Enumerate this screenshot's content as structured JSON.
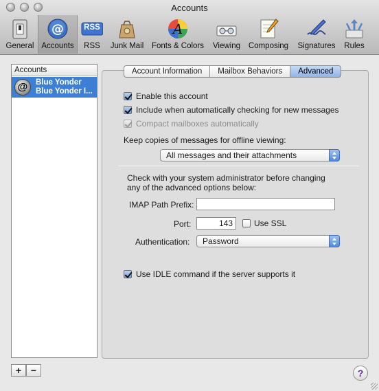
{
  "window": {
    "title": "Accounts"
  },
  "toolbar": {
    "items": [
      {
        "label": "General"
      },
      {
        "label": "Accounts",
        "selected": true
      },
      {
        "label": "RSS"
      },
      {
        "label": "Junk Mail"
      },
      {
        "label": "Fonts & Colors"
      },
      {
        "label": "Viewing"
      },
      {
        "label": "Composing"
      },
      {
        "label": "Signatures"
      },
      {
        "label": "Rules"
      }
    ],
    "rss_badge": "RSS"
  },
  "sidebar": {
    "header": "Accounts",
    "accounts": [
      {
        "name": "Blue Yonder",
        "detail": "Blue Yonder I...",
        "avatar_glyph": "@"
      }
    ],
    "add_label": "+",
    "remove_label": "−"
  },
  "tabs": [
    {
      "label": "Account Information",
      "active": false
    },
    {
      "label": "Mailbox Behaviors",
      "active": false
    },
    {
      "label": "Advanced",
      "active": true
    }
  ],
  "advanced": {
    "enable_account": {
      "label": "Enable this account",
      "checked": true
    },
    "include_check": {
      "label": "Include when automatically checking for new messages",
      "checked": true
    },
    "compact": {
      "label": "Compact mailboxes automatically",
      "checked": true,
      "disabled": true
    },
    "offline_label": "Keep copies of messages for offline viewing:",
    "offline_select": "All messages and their attachments",
    "admin_note_line1": "Check with your system administrator before changing",
    "admin_note_line2": "any of the advanced options below:",
    "imap_prefix_label": "IMAP Path Prefix:",
    "imap_prefix_value": "",
    "port_label": "Port:",
    "port_value": "143",
    "ssl": {
      "label": "Use SSL",
      "checked": false
    },
    "auth_label": "Authentication:",
    "auth_value": "Password",
    "idle": {
      "label": "Use IDLE command if the server supports it",
      "checked": true
    }
  },
  "help_label": "?",
  "colors": {
    "selection": "#3d7fd4",
    "accent_blue": "#4f8ae0"
  }
}
